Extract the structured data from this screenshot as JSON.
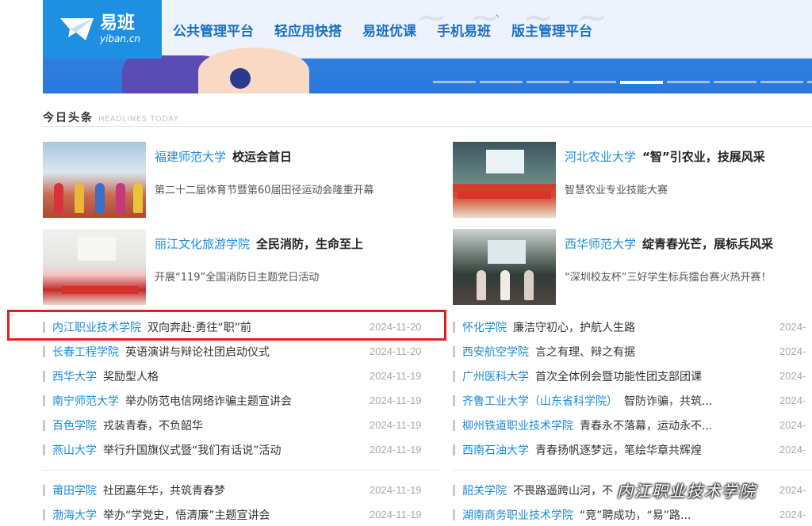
{
  "brand": {
    "name_cn": "易班",
    "name_en": "yiban.cn",
    "color": "#1f8fe2"
  },
  "nav": [
    "公共管理平台",
    "轻应用快搭",
    "易班优课",
    "手机易班",
    "版主管理平台"
  ],
  "section": {
    "title_cn": "今日头条",
    "title_en": "HEADLINES TODAY"
  },
  "featured": [
    {
      "school": "福建师范大学",
      "topic": "校运会首日",
      "desc": "第二十二届体育节暨第60届田径运动会隆重开幕"
    },
    {
      "school": "河北农业大学",
      "topic": "“智”引农业，技展风采",
      "desc": "智慧农业专业技能大赛"
    },
    {
      "school": "丽江文化旅游学院",
      "topic": "全民消防，生命至上",
      "desc": "开展“119”全国消防日主题党日活动"
    },
    {
      "school": "西华师范大学",
      "topic": "绽青春光芒，展标兵风采",
      "desc": "“深圳校友杯”三好学生标兵擂台赛火热开赛！"
    }
  ],
  "list_left": [
    {
      "school": "内江职业技术学院",
      "title": "双向奔赴·勇往“职”前",
      "date": "2024-11-20"
    },
    {
      "school": "长春工程学院",
      "title": "英语演讲与辩论社团启动仪式",
      "date": "2024-11-20"
    },
    {
      "school": "西华大学",
      "title": "奖励型人格",
      "date": "2024-11-19"
    },
    {
      "school": "南宁师范大学",
      "title": "举办防范电信网络诈骗主题宣讲会",
      "date": "2024-11-19"
    },
    {
      "school": "百色学院",
      "title": "戎装青春，不负韶华",
      "date": "2024-11-19"
    },
    {
      "school": "燕山大学",
      "title": "举行升国旗仪式暨“我们有话说”活动",
      "date": "2024-11-19"
    },
    {
      "school": "莆田学院",
      "title": "社团嘉年华，共筑青春梦",
      "date": "2024-11-19"
    },
    {
      "school": "渤海大学",
      "title": "举办“学党史，悟清廉”主题宣讲会",
      "date": "2024-11-19"
    }
  ],
  "list_right": [
    {
      "school": "怀化学院",
      "title": "廉洁守初心，护航人生路",
      "date": "2024-"
    },
    {
      "school": "西安航空学院",
      "title": "言之有理、辩之有据",
      "date": "2024-"
    },
    {
      "school": "广州医科大学",
      "title": "首次全体例会暨功能性团支部团课",
      "date": "2024-"
    },
    {
      "school": "齐鲁工业大学（山东省科学院）",
      "title": "智防诈骗，共筑...",
      "date": "2024-"
    },
    {
      "school": "柳州铁道职业技术学院",
      "title": "青春永不落幕，运动永不...",
      "date": "2024-"
    },
    {
      "school": "西南石油大学",
      "title": "青春扬帆逐梦远，笔绘华章共辉煌",
      "date": "2024-"
    },
    {
      "school": "韶关学院",
      "title": "不畏路遥跨山河，不",
      "date": "2024-"
    },
    {
      "school": "湖南商务职业技术学院",
      "title": "“竞”聘成功，“易”路...",
      "date": "2024-"
    }
  ],
  "watermark": "内江职业技术学院"
}
